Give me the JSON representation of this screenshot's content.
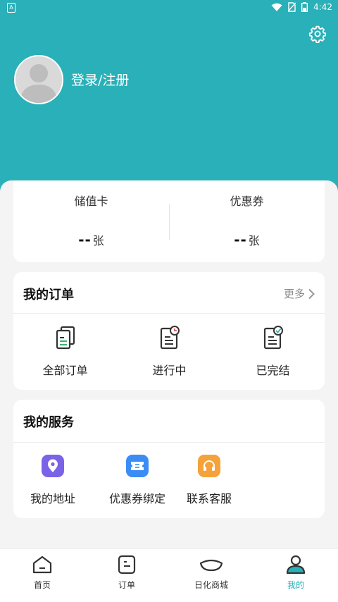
{
  "status_bar": {
    "time": "4:42"
  },
  "header": {
    "login_text": "登录/注册"
  },
  "balance": {
    "stored_value_card": {
      "label": "储值卡",
      "value": "--",
      "unit": "张"
    },
    "coupon": {
      "label": "优惠券",
      "value": "--",
      "unit": "张"
    }
  },
  "orders": {
    "title": "我的订单",
    "more_label": "更多",
    "items": [
      {
        "label": "全部订单",
        "icon": "all-orders-icon"
      },
      {
        "label": "进行中",
        "icon": "in-progress-icon"
      },
      {
        "label": "已完结",
        "icon": "completed-icon"
      }
    ]
  },
  "services": {
    "title": "我的服务",
    "items": [
      {
        "label": "我的地址",
        "icon": "location-icon",
        "color": "#7a63e6"
      },
      {
        "label": "优惠券绑定",
        "icon": "ticket-icon",
        "color": "#3b8cf5"
      },
      {
        "label": "联系客服",
        "icon": "headset-icon",
        "color": "#f5a23b"
      }
    ]
  },
  "tabbar": {
    "items": [
      {
        "label": "首页",
        "icon": "home-icon"
      },
      {
        "label": "订单",
        "icon": "order-icon"
      },
      {
        "label": "日化商城",
        "icon": "mall-icon"
      },
      {
        "label": "我的",
        "icon": "profile-icon",
        "active": true
      }
    ]
  },
  "colors": {
    "accent": "#2ab0b8",
    "inactive": "#333333"
  }
}
